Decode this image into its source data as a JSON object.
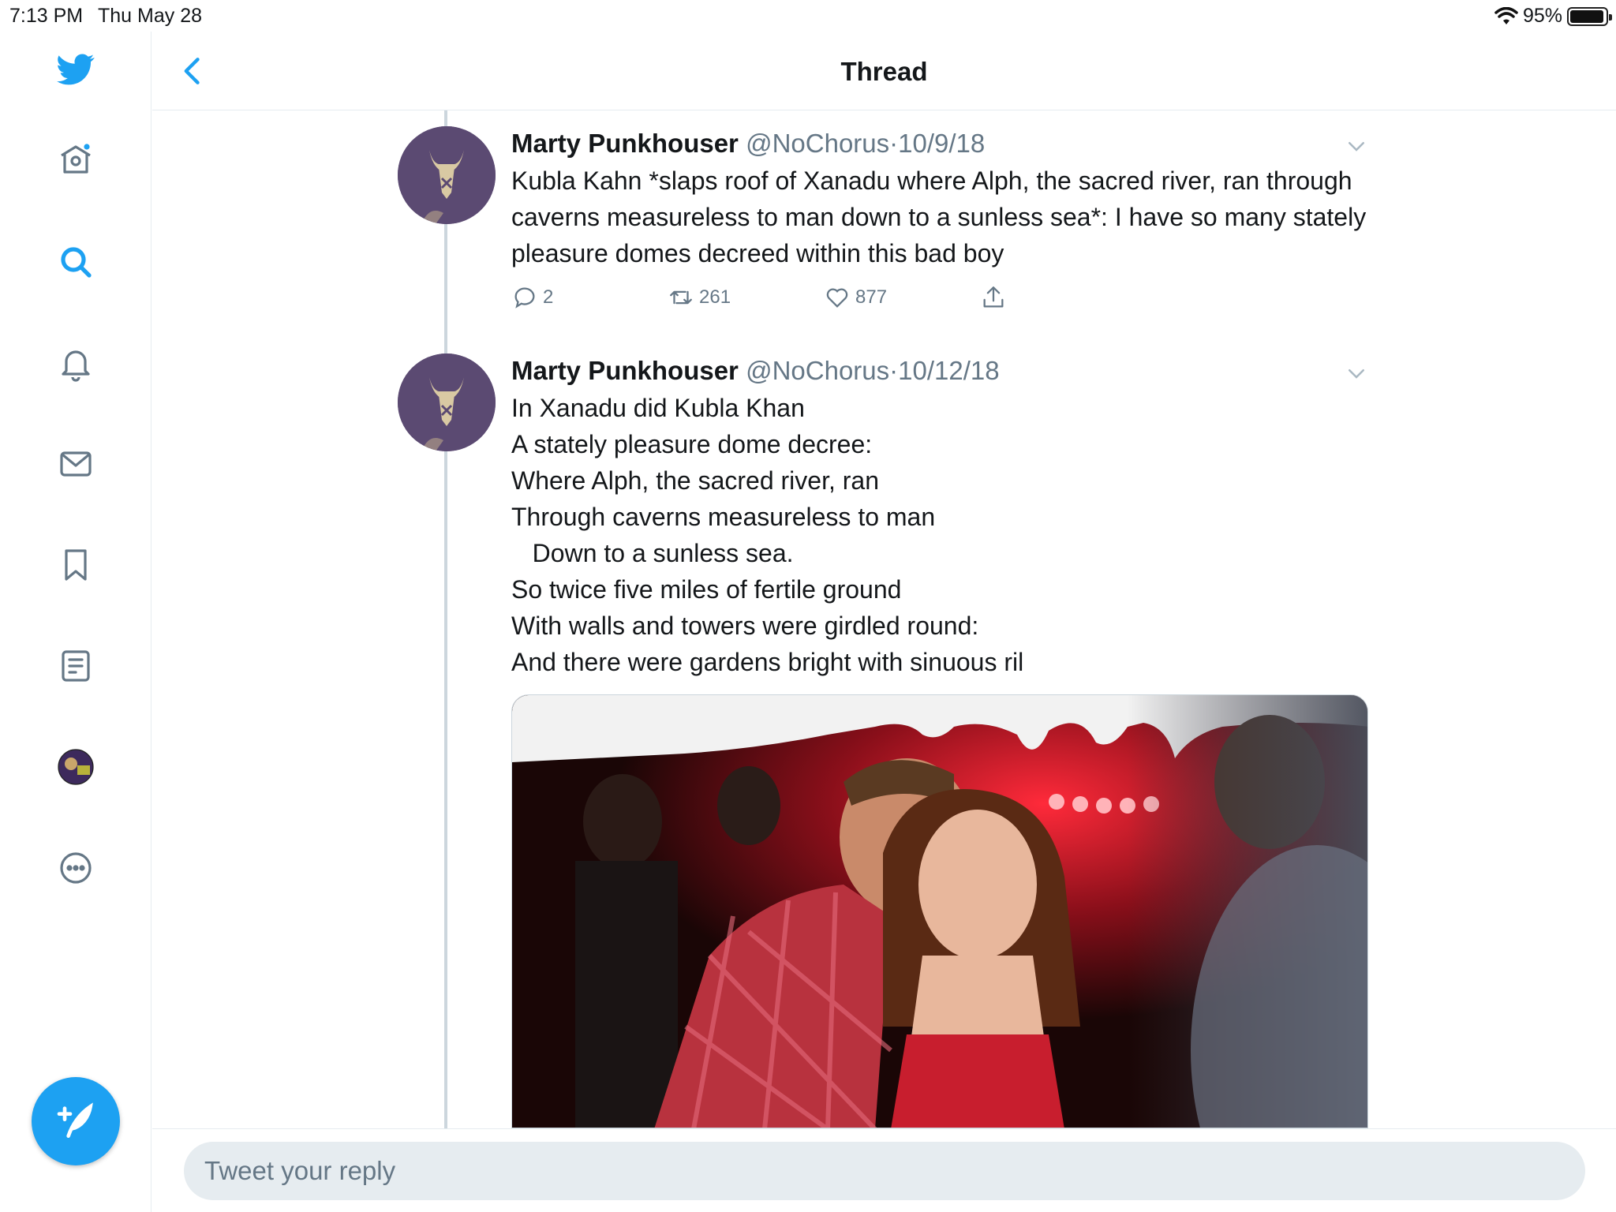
{
  "status": {
    "time": "7:13 PM",
    "date": "Thu May 28",
    "battery": "95%",
    "battery_level": 0.95
  },
  "header": {
    "title": "Thread"
  },
  "sidebar": {
    "items": [
      "twitter-logo",
      "home",
      "explore",
      "notifications",
      "messages",
      "bookmarks",
      "lists",
      "profile",
      "more"
    ]
  },
  "tweets": [
    {
      "name": "Marty Punkhouser",
      "handle": "@NoChorus",
      "dot": "·",
      "date": "10/9/18",
      "text": "Kubla Kahn *slaps roof of Xanadu where Alph, the sacred river, ran through caverns measureless to man down to a sunless sea*: I have so many stately pleasure domes decreed within this bad boy",
      "replies": "2",
      "retweets": "261",
      "likes": "877"
    },
    {
      "name": "Marty Punkhouser",
      "handle": "@NoChorus",
      "dot": "·",
      "date": "10/12/18",
      "text": "In Xanadu did Kubla Khan\nA stately pleasure dome decree:\nWhere Alph, the sacred river, ran\nThrough caverns measureless to man\n   Down to a sunless sea.\nSo twice five miles of fertile ground\nWith walls and towers were girdled round:\nAnd there were gardens bright with sinuous ril"
    }
  ],
  "reply": {
    "placeholder": "Tweet your reply"
  },
  "colors": {
    "accent": "#1da1f2",
    "secondary_text": "#657786",
    "divider": "#e6ecf0"
  }
}
